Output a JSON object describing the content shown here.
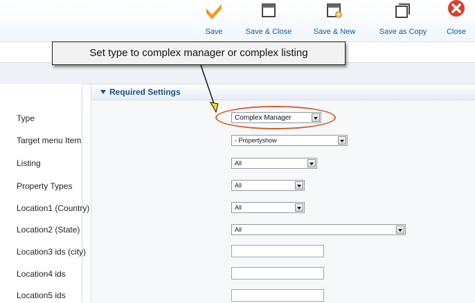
{
  "toolbar": {
    "buttons": [
      {
        "label": "Save",
        "icon": "checkmark-icon"
      },
      {
        "label": "Save & Close",
        "icon": "save-close-icon"
      },
      {
        "label": "Save & New",
        "icon": "save-new-icon"
      },
      {
        "label": "Save as Copy",
        "icon": "copy-icon"
      },
      {
        "label": "Close",
        "icon": "close-icon"
      }
    ]
  },
  "callout": {
    "text": "Set type to complex manager or complex listing"
  },
  "panel": {
    "title": "Required Settings"
  },
  "fields": [
    {
      "label": "Type",
      "value": "Complex Manager"
    },
    {
      "label": "Target menu Item",
      "value": "- Propertyshow"
    },
    {
      "label": "Listing",
      "value": "All"
    },
    {
      "label": "Property Types",
      "value": "All"
    },
    {
      "label": "Location1 (Country)",
      "value": "All"
    },
    {
      "label": "Location2 (State)",
      "value": "All"
    },
    {
      "label": "Location3 ids (city)",
      "value": ""
    },
    {
      "label": "Location4 ids",
      "value": ""
    },
    {
      "label": "Location5 ids",
      "value": ""
    }
  ],
  "colors": {
    "accent": "#f39a1e",
    "close": "#d9402a",
    "highlight": "#e05a1c",
    "link": "#0b55c4"
  }
}
